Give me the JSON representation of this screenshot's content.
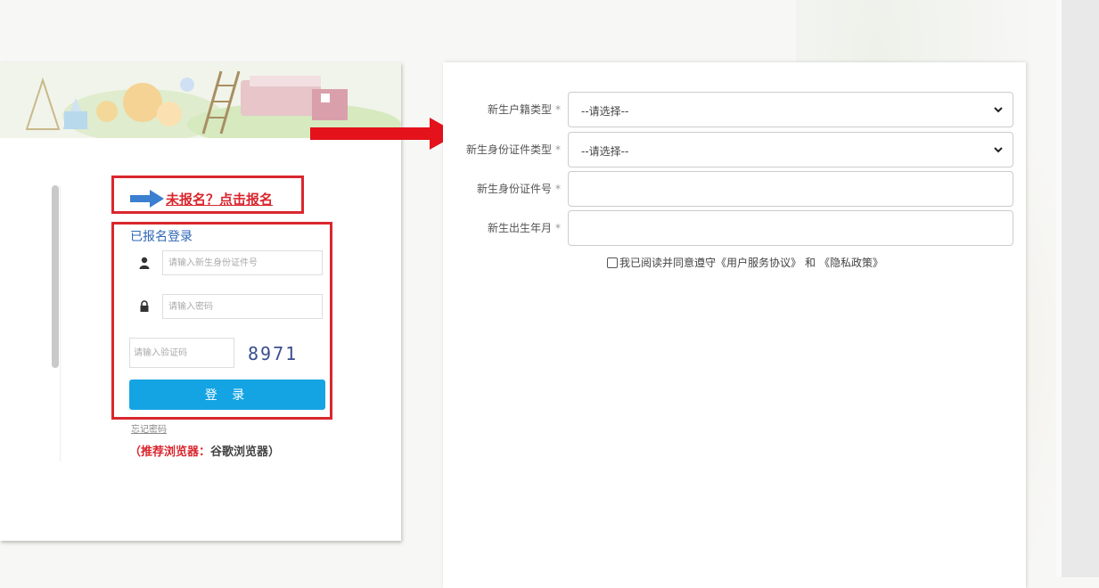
{
  "login": {
    "register_link": "未报名？点击报名",
    "title": "已报名登录",
    "id_placeholder": "请输入新生身份证件号",
    "password_placeholder": "请输入密码",
    "captcha_placeholder": "请输入验证码",
    "captcha_code": "8971",
    "login_button": "登 录",
    "forgot_password": "忘记密码",
    "browser_tip_prefix": "（推荐浏览器：",
    "browser_tip_name": "谷歌浏览器）"
  },
  "form": {
    "fields": [
      {
        "label": "新生户籍类型",
        "value": "--请选择--"
      },
      {
        "label": "新生身份证件类型",
        "value": "--请选择--"
      },
      {
        "label": "新生身份证件号",
        "value": ""
      },
      {
        "label": "新生出生年月",
        "value": ""
      }
    ],
    "required_mark": "*",
    "agree_text": "我已阅读并同意遵守",
    "user_agreement": "《用户服务协议》",
    "and_text": "和",
    "privacy_policy": "《隐私政策》"
  },
  "colors": {
    "accent_red": "#d9272e",
    "button_blue": "#14a4e4",
    "title_blue": "#2e66b5"
  }
}
